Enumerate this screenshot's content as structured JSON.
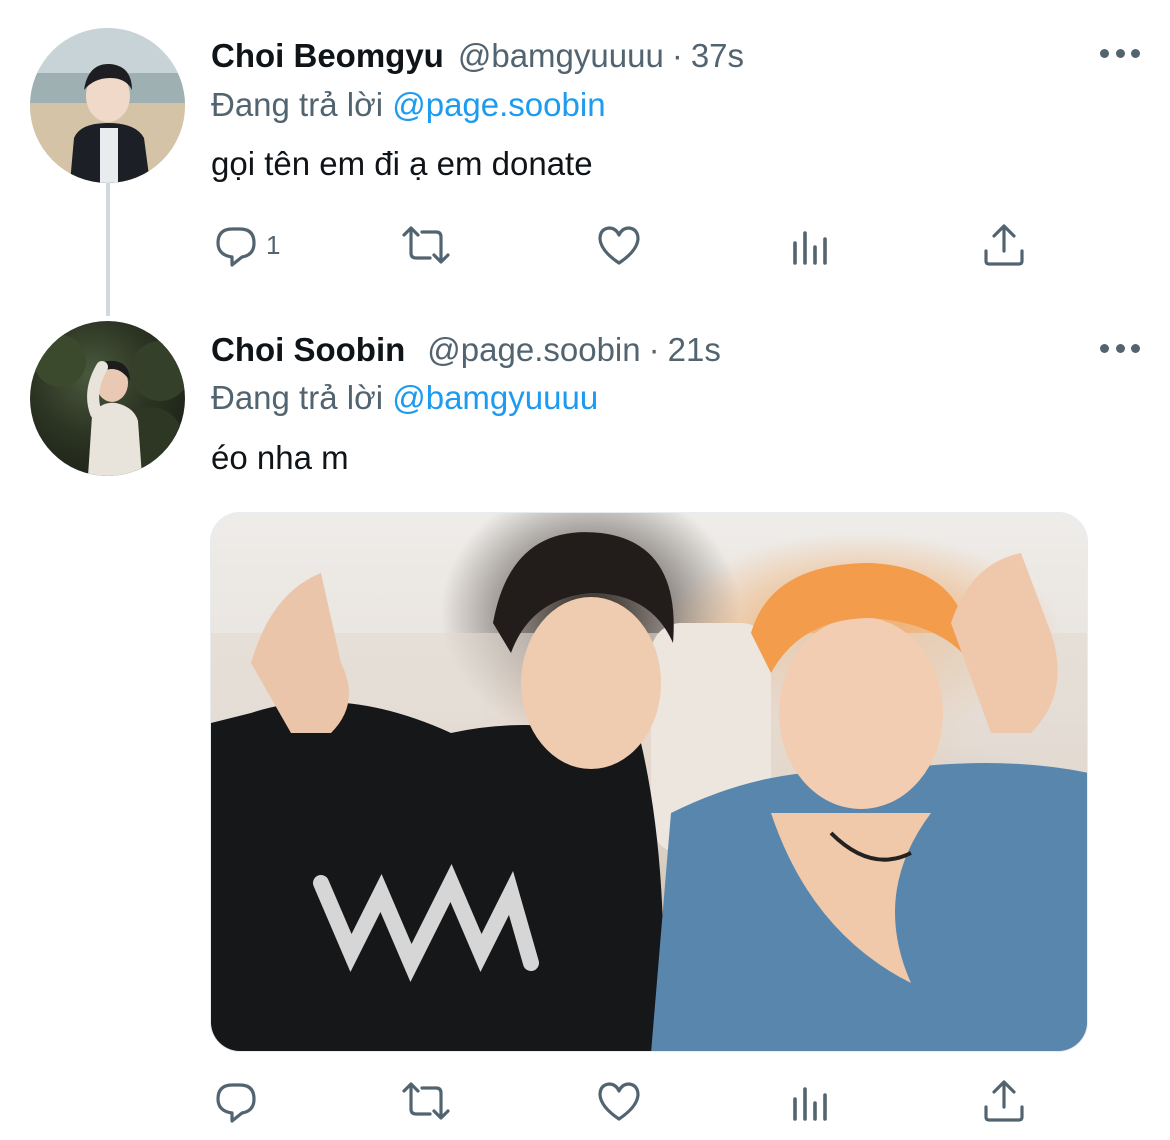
{
  "thread": [
    {
      "name": "Choi Beomgyu",
      "handle": "@bamgyuuuu",
      "dot": "·",
      "time": "37s",
      "reply_prefix": "Đang trả lời",
      "reply_to": "@page.soobin",
      "text": "gọi tên em đi ạ em donate",
      "actions": {
        "reply_count": "1"
      },
      "avatar_icon": "profile-photo"
    },
    {
      "name": "Choi Soobin",
      "handle": "@page.soobin",
      "dot": "·",
      "time": "21s",
      "reply_prefix": "Đang trả lời",
      "reply_to": "@bamgyuuuu",
      "text": "éo nha m",
      "actions": {
        "reply_count": ""
      },
      "avatar_icon": "profile-photo",
      "media": "photo"
    }
  ],
  "colors": {
    "text": "#0f1419",
    "secondary": "#536471",
    "link": "#1d9bf0",
    "thread_line": "#cfd9de"
  },
  "icons": [
    "reply-icon",
    "retweet-icon",
    "like-icon",
    "views-icon",
    "share-icon",
    "more-icon"
  ]
}
